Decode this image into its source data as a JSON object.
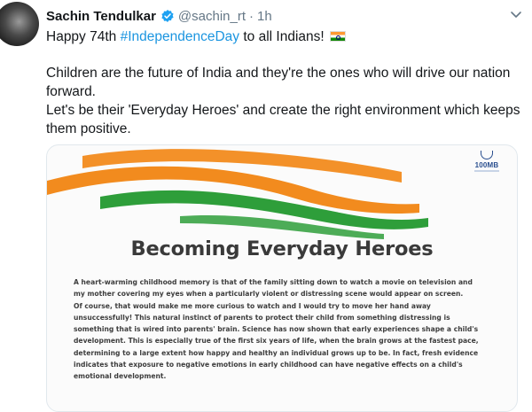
{
  "tweet": {
    "display_name": "Sachin Tendulkar",
    "handle": "@sachin_rt",
    "separator": "·",
    "timestamp": "1h",
    "line1_prefix": "Happy 74th ",
    "hashtag": "#IndependenceDay",
    "line1_suffix": " to all Indians!",
    "paragraph2": "Children are the future of India and they're the ones who will drive our nation forward.",
    "paragraph3": "Let's be their 'Everyday Heroes' and create the right environment which keeps them positive.",
    "emoji": "flag-india"
  },
  "media": {
    "brand_text": "100MB",
    "title": "Becoming Everyday Heroes",
    "body_lines": [
      "A heart-warming childhood memory is that of the family sitting down to watch a movie on television and",
      "my mother covering my eyes when a particularly violent or distressing scene would appear on screen.",
      "Of course, that would make me more curious to watch and I would try to move her hand away",
      "unsuccessfully! This natural instinct of parents to protect their child from something distressing is",
      "something that is wired into parents' brain. Science has now shown that early experiences shape a child's",
      "development. This is especially true of the first six years of life, when the brain grows at the fastest pace,",
      "determining to a large extent how happy and healthy an individual grows up to be. In fact, fresh evidence",
      "indicates that exposure to negative emotions in early childhood can have negative effects on a child's",
      "emotional development."
    ]
  },
  "colors": {
    "saffron": "#f28b1e",
    "green": "#2e9e3a",
    "link": "#1b95e0",
    "verified": "#1da1f2"
  }
}
